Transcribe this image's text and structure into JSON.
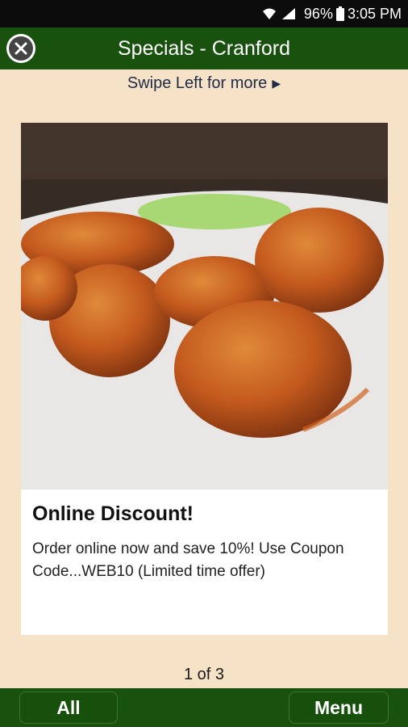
{
  "status_bar": {
    "battery": "96%",
    "time": "3:05 PM"
  },
  "header": {
    "title": "Specials - Cranford"
  },
  "swipe_hint": {
    "text": "Swipe Left for more"
  },
  "special": {
    "title": "Online Discount!",
    "body": "Order online now and save 10%! Use Coupon Code...WEB10 (Limited time offer)"
  },
  "pager": {
    "text": "1 of 3"
  },
  "bottom_bar": {
    "all_label": "All",
    "menu_label": "Menu"
  },
  "colors": {
    "header": "#19520e",
    "background": "#f6e3c7",
    "hint_text": "#1f2a49"
  }
}
